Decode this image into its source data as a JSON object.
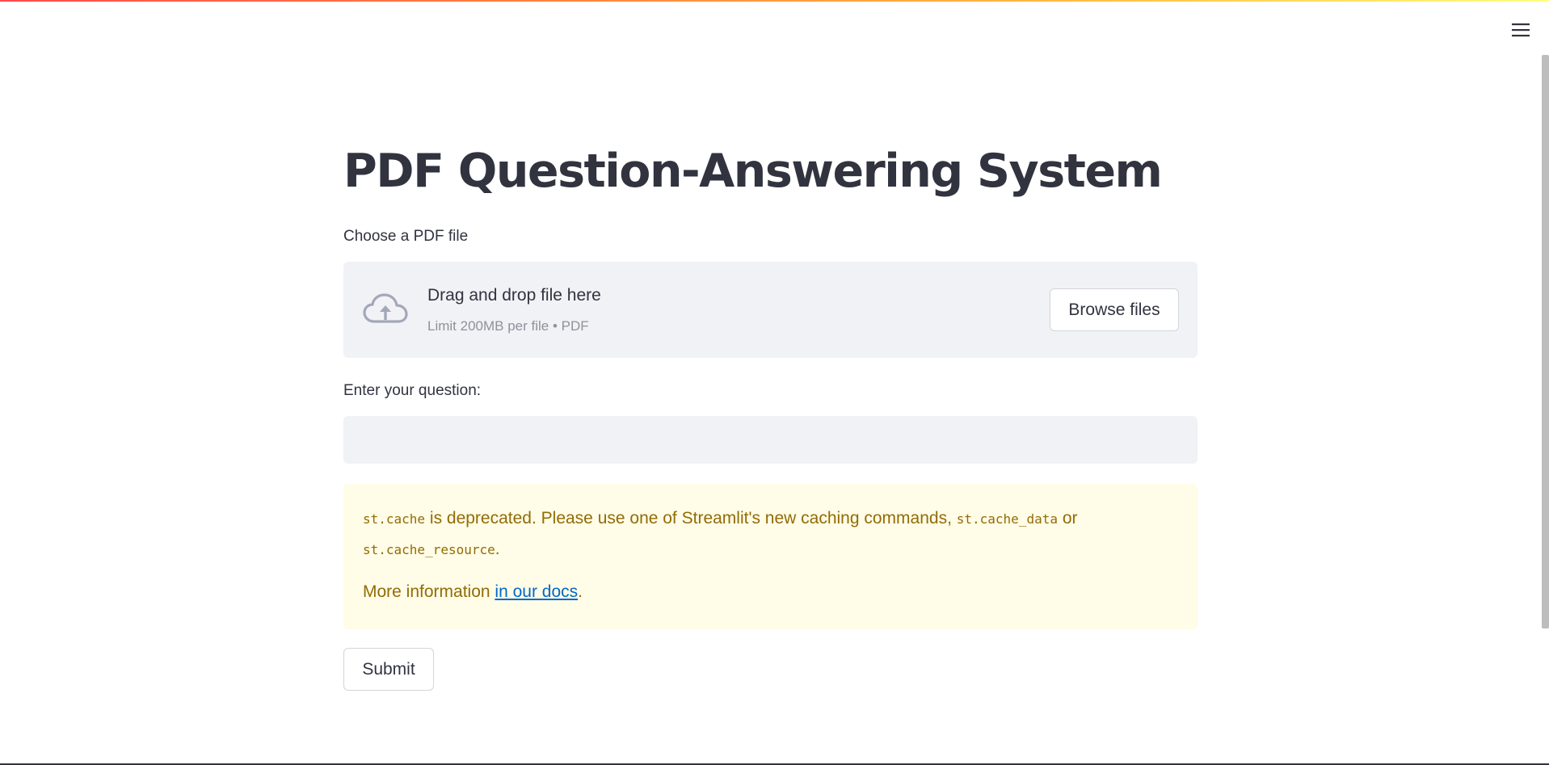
{
  "app": {
    "title": "PDF Question-Answering System",
    "colors": {
      "text": "#31333f",
      "muted_text": "#8e929a",
      "widget_background": "#f0f2f6",
      "warning_background": "#fffce7",
      "warning_text": "#926c05",
      "link": "#0068c9",
      "icon": "#a3a8b8"
    }
  },
  "header": {
    "menu_icon": "hamburger-menu-icon"
  },
  "uploader": {
    "label": "Choose a PDF file",
    "icon": "cloud-upload-icon",
    "dropzone_title": "Drag and drop file here",
    "dropzone_limit": "Limit 200MB per file • PDF",
    "browse_label": "Browse files"
  },
  "question": {
    "label": "Enter your question:",
    "value": "",
    "placeholder": ""
  },
  "warning": {
    "code_cache": "st.cache",
    "text_deprecated": " is deprecated. Please use one of Streamlit's new caching commands, ",
    "code_cache_data": "st.cache_data",
    "text_or": " or",
    "code_cache_resource": "st.cache_resource",
    "text_period": ".",
    "more_info": "More information ",
    "docs_link": "in our docs",
    "more_period": "."
  },
  "submit": {
    "label": "Submit"
  }
}
